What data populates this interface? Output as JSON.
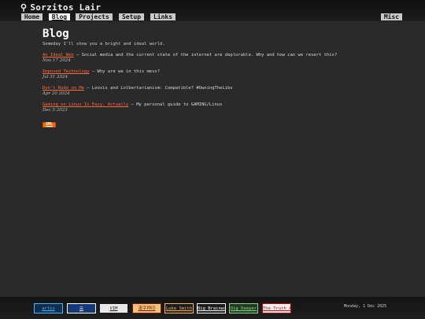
{
  "header": {
    "site_title": "Sorzitos Lair",
    "logo_icon": "gear-glyph-icon",
    "nav": [
      {
        "label": "Home",
        "active": false
      },
      {
        "label": "Blog",
        "active": true
      },
      {
        "label": "Projects",
        "active": false
      },
      {
        "label": "Setup",
        "active": false
      },
      {
        "label": "Links",
        "active": false
      }
    ],
    "misc_label": "Misc"
  },
  "main": {
    "title": "Blog",
    "subtitle": "Someday I'll show you a bright and ideal world.",
    "posts": [
      {
        "title": "An Ideal Web",
        "desc": " – Social media and the current state of the internet are deplorable. Why and how can we revert this?",
        "date": "Nov 17 2024"
      },
      {
        "title": "Imposed Technology",
        "desc": " – Why are we in this mess?",
        "date": "Jul 31 2024"
      },
      {
        "title": "Don't Rudo on Me",
        "desc": " – Looxis and Lolbertarianism: Compatible? #OwningTheLibs",
        "date": "Apr 20 2024"
      },
      {
        "title": "Gaming on Linux Is Easy, Actually",
        "desc": " – My personal guide to GAMING/Linux",
        "date": "Dec 5 2023"
      }
    ],
    "feed_badge": "XML"
  },
  "footer": {
    "badges": [
      {
        "label": "artix",
        "bg": "#0b2f52",
        "fg": "#4fb3ff"
      },
      {
        "label": "☰",
        "bg": "#153a7a",
        "fg": "#ffffff"
      },
      {
        "label": "VIM",
        "bg": "#e8e8e8",
        "fg": "#1a1a1a"
      },
      {
        "label": "漢字押印",
        "bg": "#f2c27a",
        "fg": "#7a1a00"
      },
      {
        "label": "Luke Smith",
        "bg": "#1b1b1b",
        "fg": "#ffb84d"
      },
      {
        "label": "Big Brained",
        "bg": "#1a1a1a",
        "fg": "#ffffff"
      },
      {
        "label": "Dig Deeper",
        "bg": "#1f3b1f",
        "fg": "#8fd18f"
      },
      {
        "label": "The Truth About",
        "bg": "#f0f0f0",
        "fg": "#c00000"
      }
    ],
    "date": "Monday, 1 Dec 2025"
  },
  "colors": {
    "background": "#2a2a2a",
    "link": "#ff6a3d",
    "nav_bg": "#c9c9c9",
    "rss": "#ff6600"
  }
}
